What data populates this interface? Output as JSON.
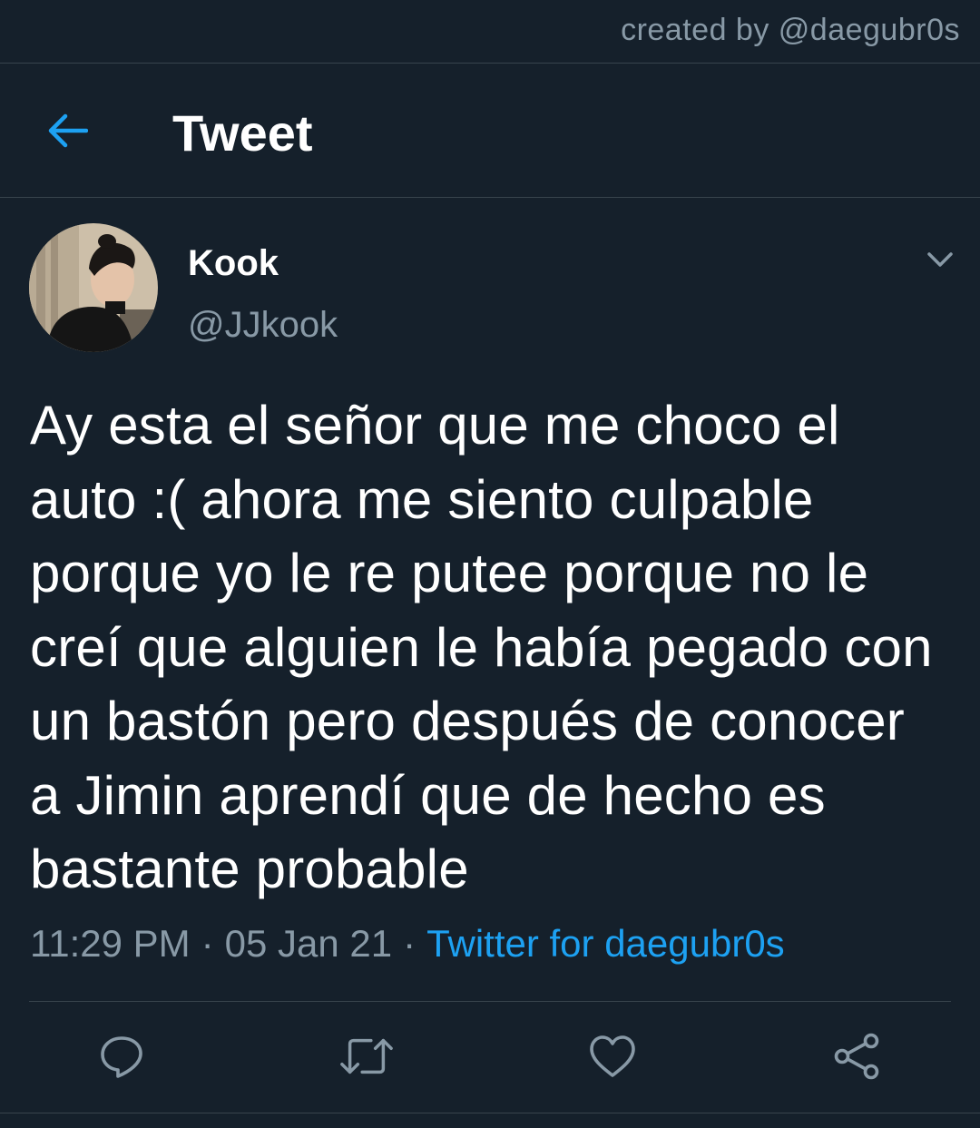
{
  "credit": "created by @daegubr0s",
  "header": {
    "title": "Tweet",
    "back_icon": "arrow-left-icon"
  },
  "author": {
    "display_name": "Kook",
    "handle": "@JJkook"
  },
  "tweet": {
    "text": "Ay esta el señor que me choco el auto :( ahora me siento culpable porque yo le re putee porque no le creí que alguien le había pegado con un bastón pero después de conocer a Jimin aprendí que de hecho es bastante probable",
    "time": "11:29 PM",
    "date": "05 Jan 21",
    "separator": "·",
    "source": "Twitter for daegubr0s"
  },
  "actions": [
    "reply-icon",
    "retweet-icon",
    "like-icon",
    "share-icon"
  ],
  "colors": {
    "background": "#15202b",
    "accent": "#1da1f2",
    "secondary_text": "#8899a6",
    "border": "#38444d"
  }
}
